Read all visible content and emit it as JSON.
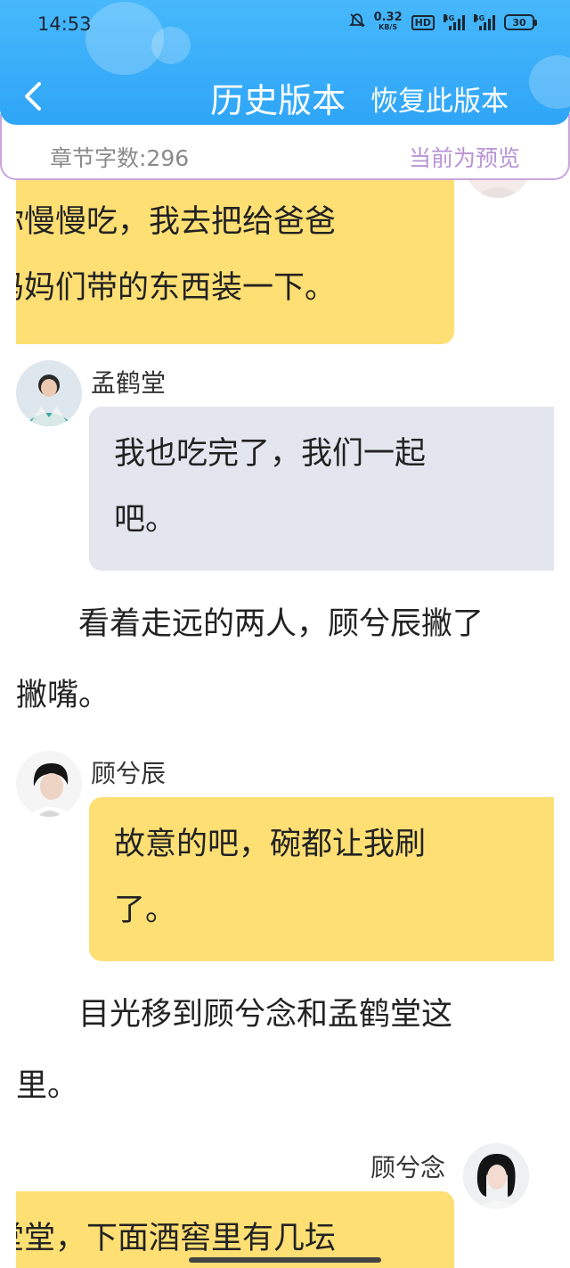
{
  "status_bar": {
    "time": "14:53",
    "net_speed_value": "0.32",
    "net_speed_unit": "KB/S",
    "hd_label": "HD",
    "signal1_label": "4G",
    "signal2_label": "4G",
    "battery": "30"
  },
  "header": {
    "title": "历史版本",
    "restore_label": "恢复此版本",
    "back_icon": "chevron-left-icon"
  },
  "info_bar": {
    "word_count": "章节字数:296",
    "preview_label": "当前为预览"
  },
  "messages": [
    {
      "lines": [
        "你慢慢吃，我去把给爸爸",
        "妈妈们带的东西装一下。"
      ]
    },
    {
      "speaker": "孟鹤堂",
      "lines": [
        "我也吃完了，我们一起",
        "吧。"
      ]
    },
    {
      "narration_lines": [
        "看着走远的两人，顾兮辰撇了",
        "撇嘴。"
      ]
    },
    {
      "speaker": "顾兮辰",
      "lines": [
        "故意的吧，碗都让我刷",
        "了。"
      ]
    },
    {
      "narration_lines": [
        "目光移到顾兮念和孟鹤堂这",
        "里。"
      ]
    },
    {
      "speaker": "顾兮念",
      "lines": [
        "堂堂，下面酒窖里有几坛"
      ]
    }
  ],
  "colors": {
    "header_blue": "#2fa5f7",
    "bubble_yellow": "#fedf74",
    "bubble_gray": "#e3e6ee",
    "preview_purple": "#b993d6"
  }
}
